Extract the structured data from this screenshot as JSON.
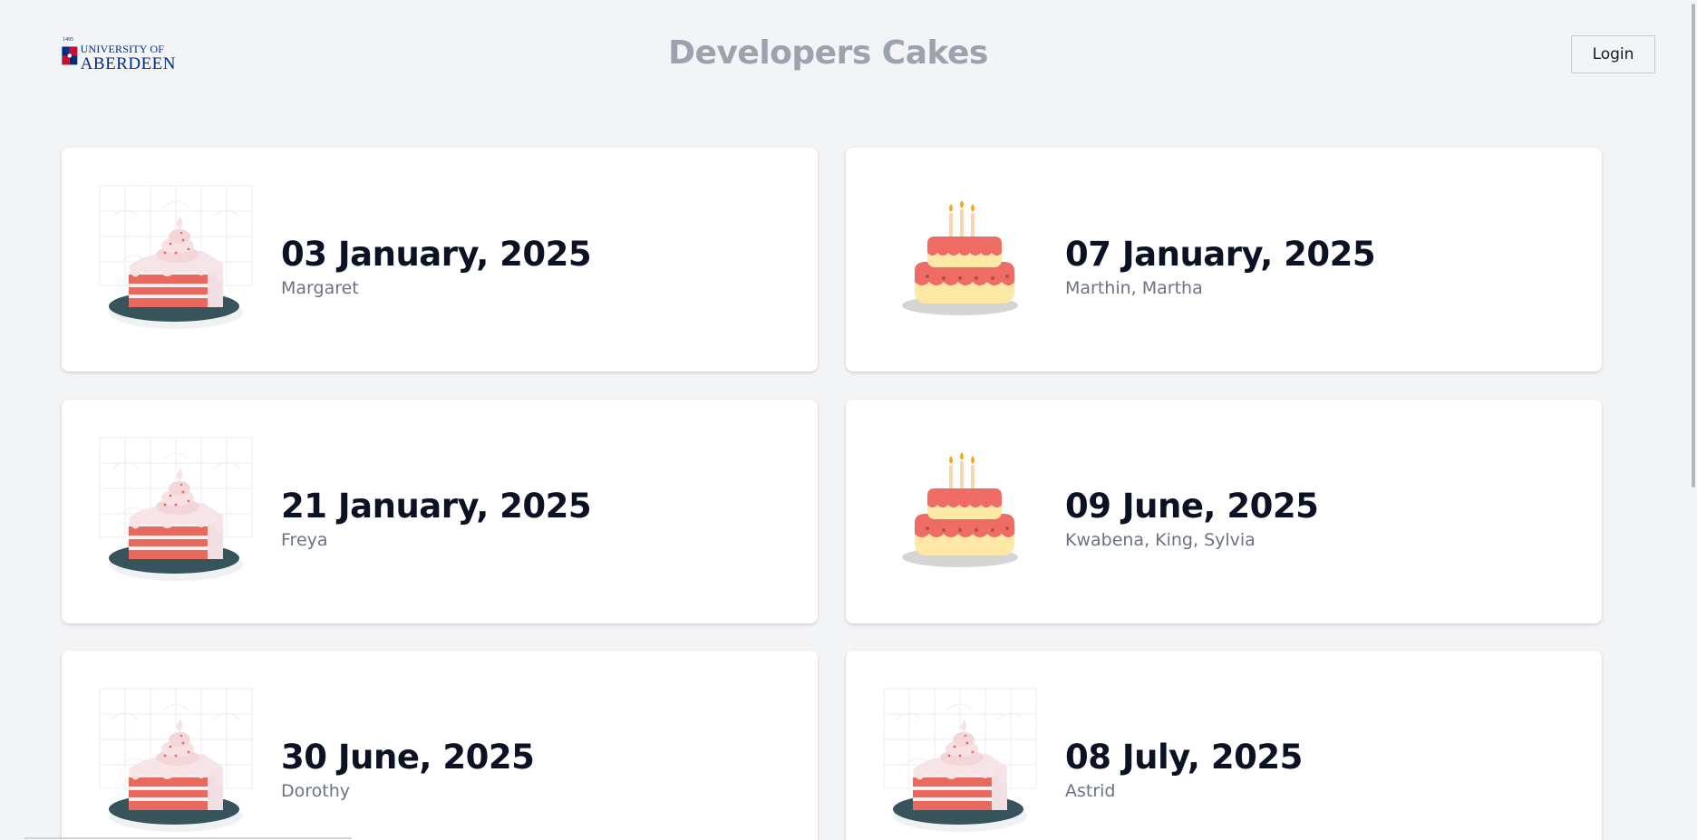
{
  "header": {
    "logo_year": "1495",
    "logo_line1": "UNIVERSITY OF",
    "logo_line2": "ABERDEEN",
    "title": "Developers Cakes",
    "login_label": "Login"
  },
  "cards": [
    {
      "date": "03 January, 2025",
      "names": "Margaret",
      "image": "cake-slice-icon"
    },
    {
      "date": "07 January, 2025",
      "names": "Marthin, Martha",
      "image": "birthday-cake-icon"
    },
    {
      "date": "21 January, 2025",
      "names": "Freya",
      "image": "cake-slice-icon"
    },
    {
      "date": "09 June, 2025",
      "names": "Kwabena, King, Sylvia",
      "image": "birthday-cake-icon"
    },
    {
      "date": "30 June, 2025",
      "names": "Dorothy",
      "image": "cake-slice-icon"
    },
    {
      "date": "08 July, 2025",
      "names": "Astrid",
      "image": "cake-slice-icon"
    }
  ],
  "colors": {
    "background": "#f3f4f6",
    "title": "#9ca3af",
    "date_text": "#0b1223",
    "names_text": "#6b7280",
    "brand_blue": "#002b7f"
  }
}
